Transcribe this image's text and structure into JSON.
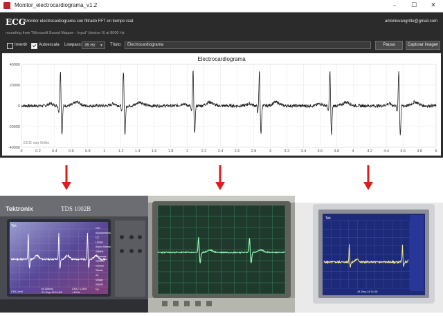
{
  "window": {
    "title": "Monitor_electrocardiograma_v1.2",
    "minimize": "–",
    "maximize": "☐",
    "close": "✕"
  },
  "header": {
    "brand": "ECG",
    "subtitle": "Monitor electrocardiograma con filtrado FFT en tiempo real.",
    "email": "antoniovangritte@gmail.com",
    "recording": "recording from \"Microsoft Sound Mapper - Input\" (device 0) at 8000 Hz"
  },
  "controls": {
    "invertir_label": "Invertir",
    "invertir_checked": false,
    "autoescala_label": "Autoescala",
    "autoescala_checked": true,
    "lowpass_label": "Lowpass:",
    "lowpass_value": "35 Hz",
    "titulo_label": "Título:",
    "titulo_value": "Electrocardiograma",
    "pause_label": "Pausa",
    "capture_label": "Capturar imagen"
  },
  "chart_data": {
    "type": "line",
    "title": "Electrocardiograma",
    "watermark": "ECG van Gritte",
    "xlim": [
      0,
      5
    ],
    "ylim": [
      -40000,
      40000
    ],
    "x_ticks": [
      "0",
      "0.2",
      "0.4",
      "0.6",
      "0.8",
      "1",
      "1.2",
      "1.4",
      "1.6",
      "1.8",
      "2",
      "2.2",
      "2.4",
      "2.6",
      "2.8",
      "3",
      "3.2",
      "3.4",
      "3.6",
      "3.8",
      "4",
      "4.2",
      "4.4",
      "4.6",
      "4.8",
      "5"
    ],
    "y_ticks": [
      "40000",
      "20000",
      "0",
      "-20000",
      "-40000"
    ],
    "grid": true,
    "series": [
      {
        "color": "#202020",
        "beats_x": [
          0.47,
          1.23,
          2.07,
          2.87,
          3.72,
          4.55
        ],
        "r_peak": 35000,
        "s_trough": -28000,
        "noise_amplitude": 1500
      }
    ]
  },
  "photos": [
    {
      "brand": "Tektronix",
      "model": "TDS 1002B",
      "status_tek": "Tek",
      "footer_left": "CH1  2mV",
      "footer_mid": "M 250ms",
      "footer_date": "24-Sep-18 11:08",
      "footer_right": "CH1 ∕ 1.00V",
      "freq": "<10Hz",
      "menu": [
        "CH1",
        "Acoplamiento",
        "CC",
        "Limitar",
        "Ancho Banda",
        "20MHz",
        "Ganancia",
        "Variable",
        "Gruesa",
        "Sonda",
        "1X",
        "Voltaje",
        "Invertir",
        "No"
      ]
    },
    {
      "brand": "",
      "model": ""
    },
    {
      "brand": "",
      "model": "",
      "status_tek": "Tek",
      "footer_date": "24-Sep-18 11:08"
    }
  ],
  "colors": {
    "arrow": "#e01b1b",
    "window_bg": "#2b2b2b",
    "plot_trace": "#202020"
  }
}
